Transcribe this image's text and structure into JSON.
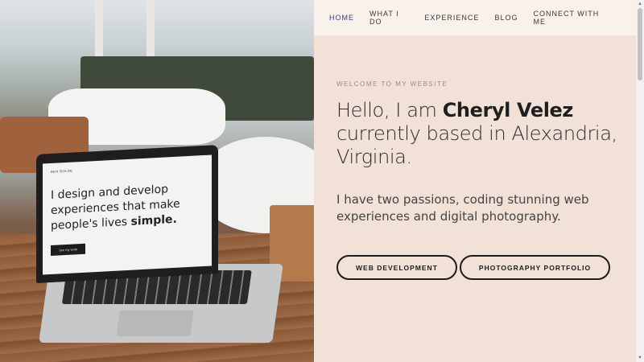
{
  "nav": {
    "items": [
      {
        "label": "HOME",
        "active": true
      },
      {
        "label": "WHAT I DO",
        "active": false
      },
      {
        "label": "EXPERIENCE",
        "active": false
      },
      {
        "label": "BLOG",
        "active": false
      },
      {
        "label": "CONNECT WITH ME",
        "active": false
      }
    ]
  },
  "hero": {
    "eyebrow": "WELCOME TO MY WEBSITE",
    "intro": "Hello, I am ",
    "name": "Cheryl Velez",
    "location": " currently based in Alexandria, Virginia.",
    "tagline": "I have two passions, coding stunning web experiences and digital photography."
  },
  "buttons": {
    "web_dev": "WEB DEVELOPMENT",
    "photography": "PHOTOGRAPHY PORTFOLIO"
  },
  "photo": {
    "laptop_site": "BEN BOLDE",
    "laptop_line1": "I design and develop",
    "laptop_line2": "experiences that make",
    "laptop_line3": "people's lives ",
    "laptop_bold": "simple.",
    "laptop_button": "See my work"
  },
  "colors": {
    "background": "#f1e1d7",
    "nav_bg": "#f8f1ec",
    "nav_active": "#3b3f74",
    "text": "#2c2c2c"
  },
  "icons": {
    "scroll_up": "triangle-up-icon",
    "scroll_down": "triangle-down-icon"
  }
}
